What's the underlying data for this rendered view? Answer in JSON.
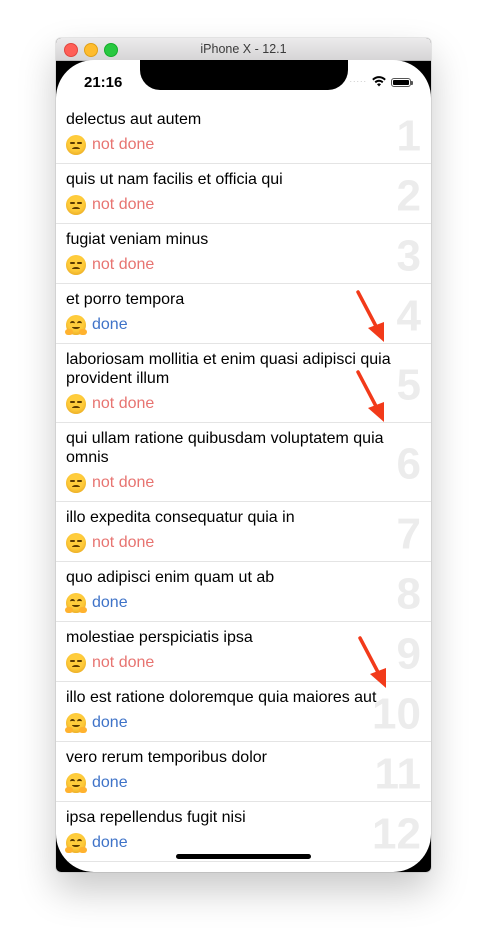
{
  "window": {
    "title": "iPhone X - 12.1"
  },
  "status_bar": {
    "time": "21:16",
    "signal": "....."
  },
  "todos": [
    {
      "text": "delectus aut autem",
      "status": "not done",
      "number": "1"
    },
    {
      "text": "quis ut nam facilis et officia qui",
      "status": "not done",
      "number": "2"
    },
    {
      "text": "fugiat veniam minus",
      "status": "not done",
      "number": "3"
    },
    {
      "text": "et porro tempora",
      "status": "done",
      "number": "4"
    },
    {
      "text": "laboriosam mollitia et enim quasi adipisci quia provident illum",
      "status": "not done",
      "number": "5"
    },
    {
      "text": "qui ullam ratione quibusdam voluptatem quia omnis",
      "status": "not done",
      "number": "6"
    },
    {
      "text": "illo expedita consequatur quia in",
      "status": "not done",
      "number": "7"
    },
    {
      "text": "quo adipisci enim quam ut ab",
      "status": "done",
      "number": "8"
    },
    {
      "text": "molestiae perspiciatis ipsa",
      "status": "not done",
      "number": "9"
    },
    {
      "text": "illo est ratione doloremque quia maiores aut",
      "status": "done",
      "number": "10"
    },
    {
      "text": "vero rerum temporibus dolor",
      "status": "done",
      "number": "11"
    },
    {
      "text": "ipsa repellendus fugit nisi",
      "status": "done",
      "number": "12"
    }
  ],
  "colors": {
    "not_done": "#e77471",
    "done": "#3f73c8",
    "annotation_arrow": "#f23a1a"
  }
}
